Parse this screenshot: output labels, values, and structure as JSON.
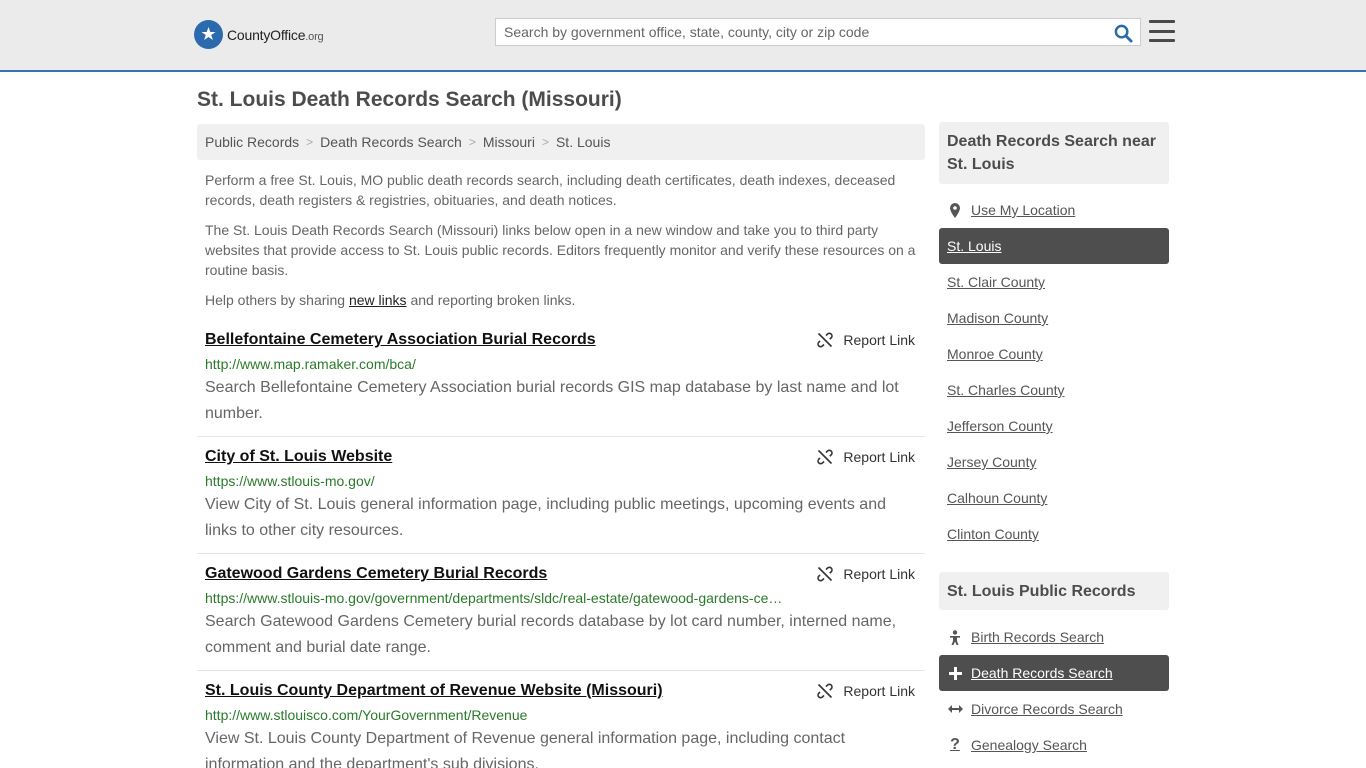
{
  "header": {
    "logo": {
      "brand_a": "County",
      "brand_b": "Office",
      "brand_c": ".org"
    },
    "search_placeholder": "Search by government office, state, county, city or zip code"
  },
  "page_title": "St. Louis Death Records Search (Missouri)",
  "breadcrumb": [
    "Public Records",
    "Death Records Search",
    "Missouri",
    "St. Louis"
  ],
  "intro": {
    "p1": "Perform a free St. Louis, MO public death records search, including death certificates, death indexes, deceased records, death registers & registries, obituaries, and death notices.",
    "p2": "The St. Louis Death Records Search (Missouri) links below open in a new window and take you to third party websites that provide access to St. Louis public records. Editors frequently monitor and verify these resources on a routine basis.",
    "p3_before": "Help others by sharing ",
    "p3_link": "new links",
    "p3_after": " and reporting broken links."
  },
  "report_label": "Report Link",
  "results": [
    {
      "title": "Bellefontaine Cemetery Association Burial Records",
      "url": "http://www.map.ramaker.com/bca/",
      "description": "Search Bellefontaine Cemetery Association burial records GIS map database by last name and lot number."
    },
    {
      "title": "City of St. Louis Website",
      "url": "https://www.stlouis-mo.gov/",
      "description": "View City of St. Louis general information page, including public meetings, upcoming events and links to other city resources."
    },
    {
      "title": "Gatewood Gardens Cemetery Burial Records",
      "url": "https://www.stlouis-mo.gov/government/departments/sldc/real-estate/gatewood-gardens-ce…",
      "description": "Search Gatewood Gardens Cemetery burial records database by lot card number, interned name, comment and burial date range."
    },
    {
      "title": "St. Louis County Department of Revenue Website (Missouri)",
      "url": "http://www.stlouisco.com/YourGovernment/Revenue",
      "description": "View St. Louis County Department of Revenue general information page, including contact information and the department's sub divisions."
    }
  ],
  "sidebar": {
    "near_heading": "Death Records Search near St. Louis",
    "use_location": "Use My Location",
    "near_items": [
      "St. Louis",
      "St. Clair County",
      "Madison County",
      "Monroe County",
      "St. Charles County",
      "Jefferson County",
      "Jersey County",
      "Calhoun County",
      "Clinton County"
    ],
    "near_active": "St. Louis",
    "records_heading": "St. Louis Public Records",
    "records_items": [
      {
        "label": "Birth Records Search",
        "icon": "baby-icon"
      },
      {
        "label": "Death Records Search",
        "icon": "plus-icon"
      },
      {
        "label": "Divorce Records Search",
        "icon": "arrows-horizontal-icon"
      },
      {
        "label": "Genealogy Search",
        "icon": "question-icon"
      }
    ],
    "records_active": "Death Records Search"
  }
}
